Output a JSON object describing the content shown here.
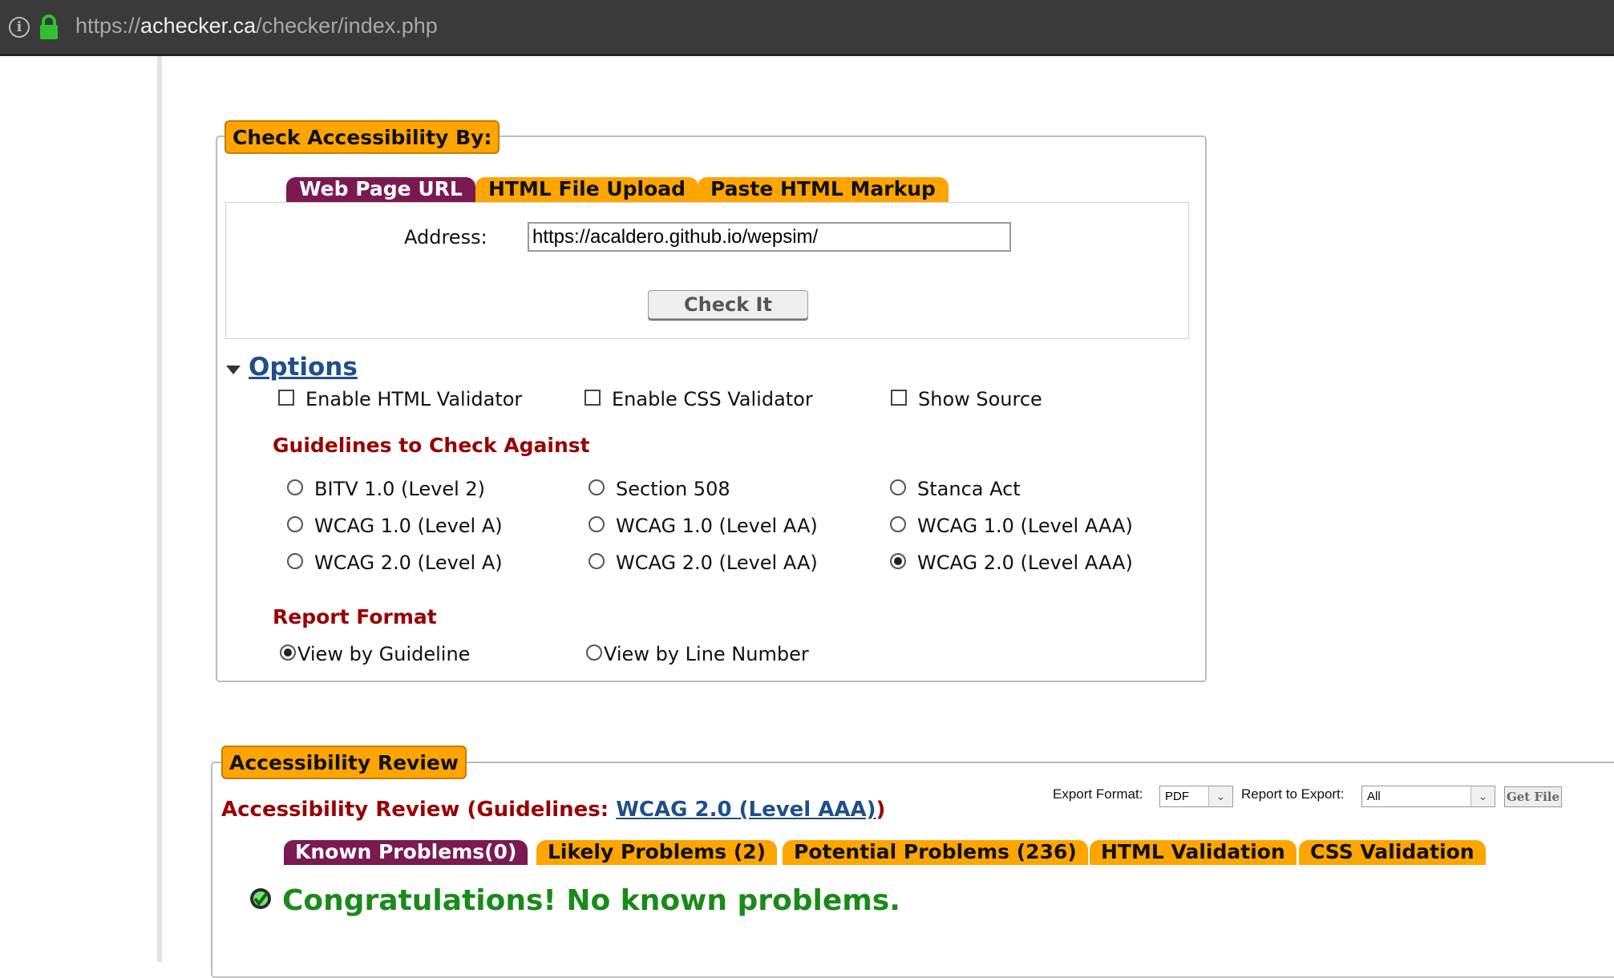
{
  "browser": {
    "url_prefix": "https://",
    "url_host": "achecker.ca",
    "url_path": "/checker/index.php"
  },
  "check_box": {
    "legend": "Check Accessibility By:",
    "tabs": [
      "Web Page URL",
      "HTML File Upload",
      "Paste HTML Markup"
    ],
    "active_tab": "Web Page URL",
    "address_label": "Address:",
    "address_value": "https://acaldero.github.io/wepsim/",
    "check_button": "Check It"
  },
  "options": {
    "toggle_label": "Options",
    "checkboxes": [
      {
        "label": "Enable HTML Validator",
        "checked": false
      },
      {
        "label": "Enable CSS Validator",
        "checked": false
      },
      {
        "label": "Show Source",
        "checked": false
      }
    ],
    "guidelines_heading": "Guidelines to Check Against",
    "guidelines": [
      {
        "label": "BITV 1.0 (Level 2)",
        "checked": false
      },
      {
        "label": "Section 508",
        "checked": false
      },
      {
        "label": "Stanca Act",
        "checked": false
      },
      {
        "label": "WCAG 1.0 (Level A)",
        "checked": false
      },
      {
        "label": "WCAG 1.0 (Level AA)",
        "checked": false
      },
      {
        "label": "WCAG 1.0 (Level AAA)",
        "checked": false
      },
      {
        "label": "WCAG 2.0 (Level A)",
        "checked": false
      },
      {
        "label": "WCAG 2.0 (Level AA)",
        "checked": false
      },
      {
        "label": "WCAG 2.0 (Level AAA)",
        "checked": true
      }
    ],
    "report_heading": "Report Format",
    "report_formats": [
      {
        "label": "View by Guideline",
        "checked": true
      },
      {
        "label": "View by Line Number",
        "checked": false
      }
    ]
  },
  "review": {
    "legend": "Accessibility Review",
    "title_prefix": "Accessibility Review (Guidelines: ",
    "title_link": "WCAG 2.0 (Level AAA)",
    "title_suffix": ")",
    "export_format_label": "Export Format:",
    "export_format_value": "PDF",
    "report_export_label": "Report to Export:",
    "report_export_value": "All",
    "get_file_button": "Get File",
    "tabs": [
      "Known Problems(0)",
      "Likely Problems (2)",
      "Potential Problems (236)",
      "HTML Validation",
      "CSS Validation"
    ],
    "active_tab": "Known Problems(0)",
    "message": "Congratulations! No known problems."
  },
  "colors": {
    "tab_orange": "#ffa500",
    "tab_active": "#7a1a50",
    "heading_red": "#990000",
    "link_blue": "#1f4f8a",
    "success_green": "#1a8a1a"
  }
}
